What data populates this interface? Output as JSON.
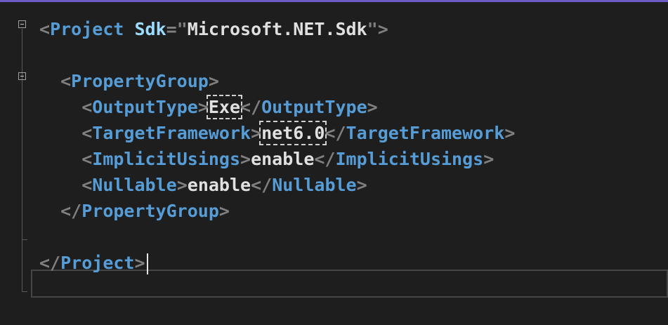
{
  "lines": [
    [
      {
        "t": "<",
        "c": "punc"
      },
      {
        "t": "Project",
        "c": "tag"
      },
      {
        "t": " ",
        "c": "text"
      },
      {
        "t": "Sdk",
        "c": "attr"
      },
      {
        "t": "=",
        "c": "punc"
      },
      {
        "t": "\"",
        "c": "punc"
      },
      {
        "t": "Microsoft.NET.Sdk",
        "c": "text"
      },
      {
        "t": "\"",
        "c": "punc"
      },
      {
        "t": ">",
        "c": "punc"
      }
    ],
    [],
    [
      {
        "t": "  ",
        "c": "text"
      },
      {
        "t": "<",
        "c": "punc"
      },
      {
        "t": "PropertyGroup",
        "c": "tag"
      },
      {
        "t": ">",
        "c": "punc"
      }
    ],
    [
      {
        "t": "    ",
        "c": "text"
      },
      {
        "t": "<",
        "c": "punc"
      },
      {
        "t": "OutputType",
        "c": "tag"
      },
      {
        "t": ">",
        "c": "punc"
      },
      {
        "t": "Exe",
        "c": "text",
        "box": true
      },
      {
        "t": "</",
        "c": "punc"
      },
      {
        "t": "OutputType",
        "c": "tag"
      },
      {
        "t": ">",
        "c": "punc"
      }
    ],
    [
      {
        "t": "    ",
        "c": "text"
      },
      {
        "t": "<",
        "c": "punc"
      },
      {
        "t": "TargetFramework",
        "c": "tag"
      },
      {
        "t": ">",
        "c": "punc"
      },
      {
        "t": "net6.0",
        "c": "text",
        "box": true
      },
      {
        "t": "</",
        "c": "punc"
      },
      {
        "t": "TargetFramework",
        "c": "tag"
      },
      {
        "t": ">",
        "c": "punc"
      }
    ],
    [
      {
        "t": "    ",
        "c": "text"
      },
      {
        "t": "<",
        "c": "punc"
      },
      {
        "t": "ImplicitUsings",
        "c": "tag"
      },
      {
        "t": ">",
        "c": "punc"
      },
      {
        "t": "enable",
        "c": "text"
      },
      {
        "t": "</",
        "c": "punc"
      },
      {
        "t": "ImplicitUsings",
        "c": "tag"
      },
      {
        "t": ">",
        "c": "punc"
      }
    ],
    [
      {
        "t": "    ",
        "c": "text"
      },
      {
        "t": "<",
        "c": "punc"
      },
      {
        "t": "Nullable",
        "c": "tag"
      },
      {
        "t": ">",
        "c": "punc"
      },
      {
        "t": "enable",
        "c": "text"
      },
      {
        "t": "</",
        "c": "punc"
      },
      {
        "t": "Nullable",
        "c": "tag"
      },
      {
        "t": ">",
        "c": "punc"
      }
    ],
    [
      {
        "t": "  ",
        "c": "text"
      },
      {
        "t": "</",
        "c": "punc"
      },
      {
        "t": "PropertyGroup",
        "c": "tag"
      },
      {
        "t": ">",
        "c": "punc"
      }
    ],
    [],
    [
      {
        "t": "</",
        "c": "punc"
      },
      {
        "t": "Project",
        "c": "tag"
      },
      {
        "t": ">",
        "c": "punc"
      }
    ]
  ],
  "caret_line": 9,
  "icons": {
    "fold": "collapse-icon"
  }
}
